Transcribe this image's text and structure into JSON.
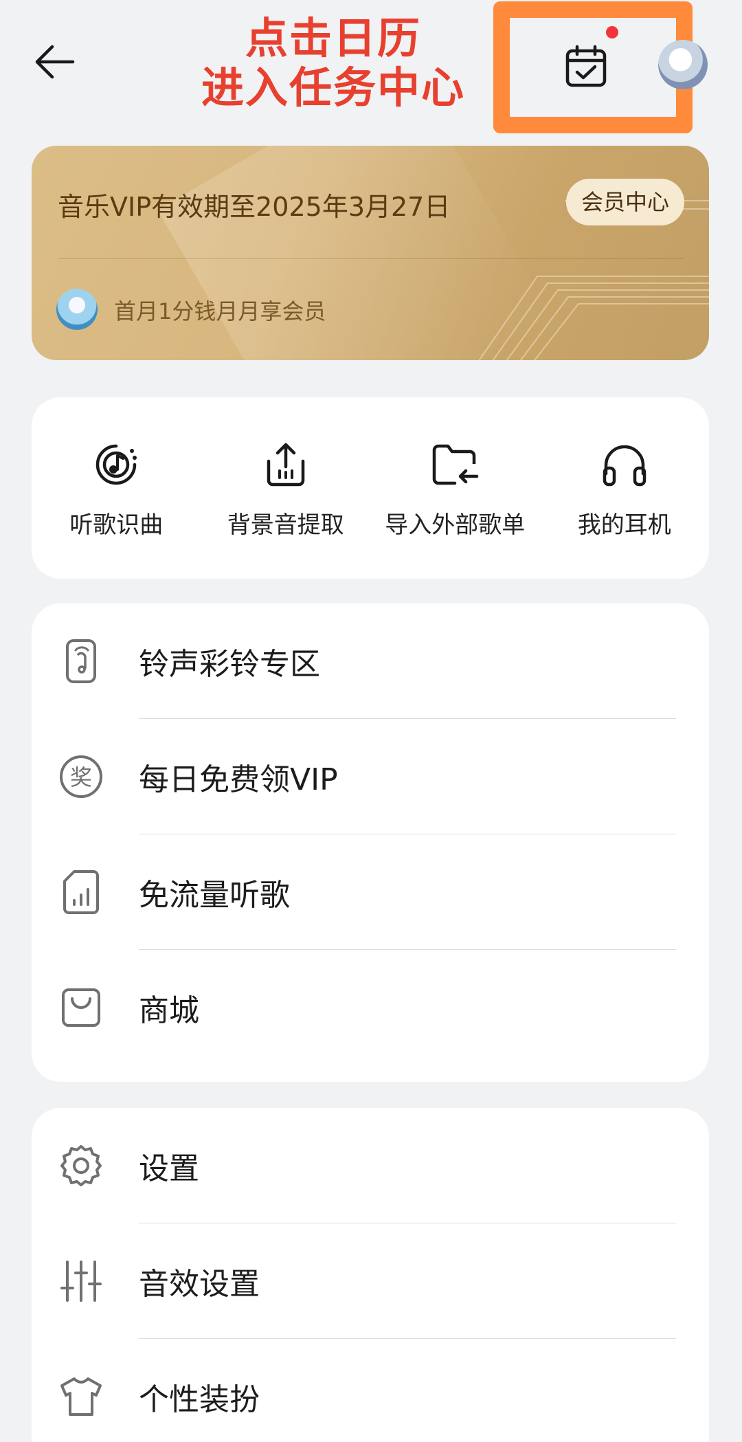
{
  "annotation": {
    "line1": "点击日历",
    "line2": "进入任务中心"
  },
  "vip": {
    "title": "音乐VIP有效期至2025年3月27日",
    "member_center": "会员中心",
    "promo": "首月1分钱月月享会员"
  },
  "quick_actions": [
    {
      "label": "听歌识曲",
      "icon": "music-recognition-icon"
    },
    {
      "label": "背景音提取",
      "icon": "upload-extract-icon"
    },
    {
      "label": "导入外部歌单",
      "icon": "folder-import-icon"
    },
    {
      "label": "我的耳机",
      "icon": "headphones-icon"
    }
  ],
  "list1": [
    {
      "label": "铃声彩铃专区",
      "icon": "ringtone-icon"
    },
    {
      "label": "每日免费领VIP",
      "icon": "reward-badge-icon"
    },
    {
      "label": "免流量听歌",
      "icon": "sim-data-icon"
    },
    {
      "label": "商城",
      "icon": "shopping-bag-icon"
    }
  ],
  "list2": [
    {
      "label": "设置",
      "icon": "gear-icon"
    },
    {
      "label": "音效设置",
      "icon": "equalizer-icon"
    },
    {
      "label": "个性装扮",
      "icon": "tshirt-icon"
    }
  ],
  "colors": {
    "annotation_text": "#e8402f",
    "highlight_border": "#ff8a3c",
    "notify_dot": "#f2343a",
    "vip_gold": "#d8b77f"
  }
}
